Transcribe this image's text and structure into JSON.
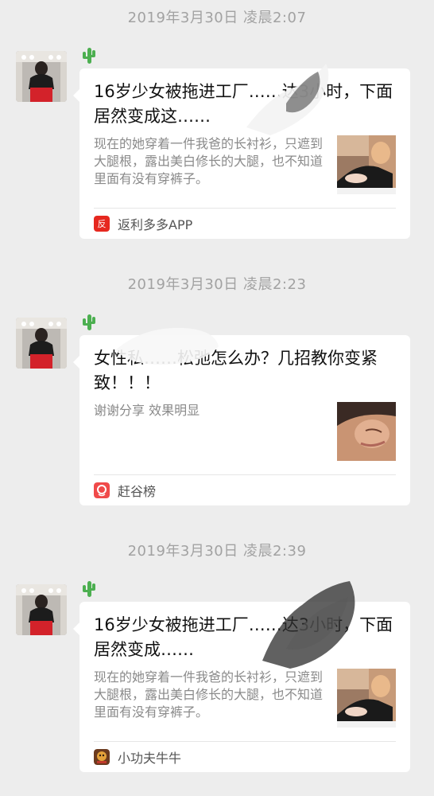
{
  "messages": [
    {
      "timestamp": "2019年3月30日 凌晨2:07",
      "title": "16岁少女被拖进工厂……达3小时，下面居然变成这……",
      "description": "现在的她穿着一件我爸的长衬衫，只遮到大腿根，露出美白修长的大腿，也不知道里面有没有穿裤子。",
      "source": {
        "name": "返利多多APP",
        "icon": "fanli-app-icon",
        "color": "#e6281f"
      },
      "thumbnail": "woman-lingerie-photo"
    },
    {
      "timestamp": "2019年3月30日 凌晨2:23",
      "title": "女性私……松弛怎么办？几招教你变紧致！！！",
      "description": "谢谢分享 效果明显",
      "source": {
        "name": "赶谷榜",
        "icon": "gangu-app-icon",
        "color": "#f04a4a"
      },
      "thumbnail": "woman-face-closeup-photo"
    },
    {
      "timestamp": "2019年3月30日 凌晨2:39",
      "title": "16岁少女被拖进工厂……达3小时，下面居然变成……",
      "description": "现在的她穿着一件我爸的长衬衫，只遮到大腿根，露出美白修长的大腿，也不知道里面有没有穿裤子。",
      "source": {
        "name": "小功夫牛牛",
        "icon": "kungfu-game-icon",
        "color": "#c0392b"
      },
      "thumbnail": "woman-lingerie-photo"
    }
  ],
  "sender": {
    "avatar": "user-avatar-photo",
    "badge": "cactus-icon"
  }
}
